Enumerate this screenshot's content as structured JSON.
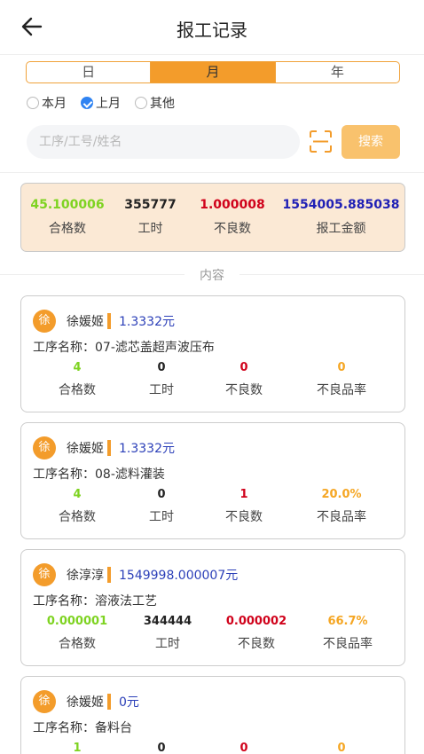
{
  "header": {
    "title": "报工记录"
  },
  "segments": [
    "日",
    "月",
    "年"
  ],
  "radios": [
    {
      "label": "本月",
      "checked": false
    },
    {
      "label": "上月",
      "checked": true
    },
    {
      "label": "其他",
      "checked": false
    }
  ],
  "search": {
    "placeholder": "工序/工号/姓名",
    "button": "搜索"
  },
  "summary": [
    {
      "value": "45.100006",
      "label": "合格数",
      "color": "#7ed321"
    },
    {
      "value": "355777",
      "label": "工时",
      "color": "#222222"
    },
    {
      "value": "1.000008",
      "label": "不良数",
      "color": "#d0021b"
    },
    {
      "value": "1554005.885038",
      "label": "报工金额",
      "color": "#1f1fb5"
    }
  ],
  "section_label": "内容",
  "stat_labels": [
    "合格数",
    "工时",
    "不良数",
    "不良品率"
  ],
  "records": [
    {
      "avatar": "徐",
      "name": "徐媛姬",
      "amount": "1.3332元",
      "process": "工序名称：07-滤芯盖超声波压布",
      "qualified": "4",
      "hours": "0",
      "defects": "0",
      "rate": "0"
    },
    {
      "avatar": "徐",
      "name": "徐媛姬",
      "amount": "1.3332元",
      "process": "工序名称：08-滤料灌装",
      "qualified": "4",
      "hours": "0",
      "defects": "1",
      "rate": "20.0%"
    },
    {
      "avatar": "徐",
      "name": "徐淳淳",
      "amount": "1549998.000007元",
      "process": "工序名称：溶液法工艺",
      "qualified": "0.000001",
      "hours": "344444",
      "defects": "0.000002",
      "rate": "66.7%"
    },
    {
      "avatar": "徐",
      "name": "徐媛姬",
      "amount": "0元",
      "process": "工序名称：备料台",
      "qualified": "1",
      "hours": "0",
      "defects": "0",
      "rate": "0"
    }
  ]
}
